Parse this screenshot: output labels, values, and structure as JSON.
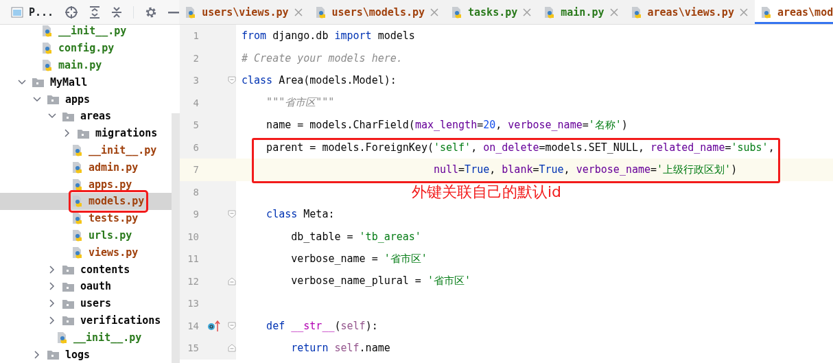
{
  "project_panel": {
    "title": "P..."
  },
  "tabs": [
    {
      "label": "users\\views.py",
      "color": "#a0410d",
      "selected": false,
      "closable": true
    },
    {
      "label": "users\\models.py",
      "color": "#a0410d",
      "selected": false,
      "closable": true
    },
    {
      "label": "tasks.py",
      "color": "#2a7a1c",
      "selected": false,
      "closable": true
    },
    {
      "label": "main.py",
      "color": "#2a7a1c",
      "selected": false,
      "closable": true
    },
    {
      "label": "areas\\views.py",
      "color": "#a0410d",
      "selected": false,
      "closable": true
    },
    {
      "label": "areas\\mod",
      "color": "#a0410d",
      "selected": true
    }
  ],
  "tree": [
    {
      "kind": "continued",
      "children": [
        {
          "kind": "file",
          "label": "__init__.py",
          "color": "#2a7a1c",
          "selected": false
        },
        {
          "kind": "file",
          "label": "config.py",
          "color": "#2a7a1c",
          "selected": false
        },
        {
          "kind": "file",
          "label": "main.py",
          "color": "#2a7a1c",
          "selected": false
        }
      ]
    },
    {
      "kind": "folder",
      "label": "MyMall",
      "expanded": true,
      "selected": false,
      "children": [
        {
          "kind": "folder",
          "label": "apps",
          "expanded": true,
          "selected": false,
          "children": [
            {
              "kind": "folder",
              "label": "areas",
              "expanded": true,
              "selected": false,
              "children": [
                {
                  "kind": "folder",
                  "label": "migrations",
                  "expanded": false,
                  "selected": false
                },
                {
                  "kind": "file",
                  "label": "__init__.py",
                  "color": "#a0410d",
                  "selected": false
                },
                {
                  "kind": "file",
                  "label": "admin.py",
                  "color": "#a0410d",
                  "selected": false
                },
                {
                  "kind": "file",
                  "label": "apps.py",
                  "color": "#a0410d",
                  "selected": false
                },
                {
                  "kind": "file",
                  "label": "models.py",
                  "color": "#a0410d",
                  "selected": true,
                  "boxed": true
                },
                {
                  "kind": "file",
                  "label": "tests.py",
                  "color": "#a0410d",
                  "selected": false
                },
                {
                  "kind": "file",
                  "label": "urls.py",
                  "color": "#2a7a1c",
                  "selected": false
                },
                {
                  "kind": "file",
                  "label": "views.py",
                  "color": "#a0410d",
                  "selected": false
                }
              ]
            },
            {
              "kind": "folder",
              "label": "contents",
              "expanded": false,
              "selected": false
            },
            {
              "kind": "folder",
              "label": "oauth",
              "expanded": false,
              "selected": false
            },
            {
              "kind": "folder",
              "label": "users",
              "expanded": false,
              "selected": false
            },
            {
              "kind": "folder",
              "label": "verifications",
              "expanded": false,
              "selected": false
            },
            {
              "kind": "file",
              "label": "__init__.py",
              "color": "#2a7a1c",
              "selected": false
            }
          ]
        },
        {
          "kind": "folder",
          "label": "logs",
          "expanded": false,
          "selected": false
        }
      ]
    }
  ],
  "code_lines": [
    {
      "number": "1",
      "current": false,
      "tokens": [
        {
          "text": "from",
          "kind": "kw"
        },
        {
          "text": " django.db ",
          "kind": "plain"
        },
        {
          "text": "import",
          "kind": "kw"
        },
        {
          "text": " models",
          "kind": "plain"
        }
      ]
    },
    {
      "number": "2",
      "current": false,
      "tokens": [
        {
          "text": "# Create your models here.",
          "kind": "cmt"
        }
      ]
    },
    {
      "number": "3",
      "current": false,
      "fold_start": true,
      "tokens": [
        {
          "text": "class",
          "kind": "kw"
        },
        {
          "text": " Area(models.Model):",
          "kind": "plain"
        }
      ]
    },
    {
      "number": "4",
      "current": false,
      "tokens": [
        {
          "text": "    \"\"\"省市区\"\"\"",
          "kind": "doc"
        }
      ]
    },
    {
      "number": "5",
      "current": false,
      "tokens": [
        {
          "text": "    name = models.CharField(",
          "kind": "plain"
        },
        {
          "text": "max_length",
          "kind": "param"
        },
        {
          "text": "=",
          "kind": "plain"
        },
        {
          "text": "20",
          "kind": "num"
        },
        {
          "text": ", ",
          "kind": "plain"
        },
        {
          "text": "verbose_name",
          "kind": "param"
        },
        {
          "text": "=",
          "kind": "plain"
        },
        {
          "text": "'名称'",
          "kind": "str"
        },
        {
          "text": ")",
          "kind": "plain"
        }
      ]
    },
    {
      "number": "6",
      "current": false,
      "boxed": true,
      "tokens": [
        {
          "text": "    parent = models.ForeignKey(",
          "kind": "plain"
        },
        {
          "text": "'self'",
          "kind": "str"
        },
        {
          "text": ", ",
          "kind": "plain"
        },
        {
          "text": "on_delete",
          "kind": "param"
        },
        {
          "text": "=models.SET_NULL, ",
          "kind": "plain"
        },
        {
          "text": "related_name",
          "kind": "param"
        },
        {
          "text": "=",
          "kind": "plain"
        },
        {
          "text": "'subs'",
          "kind": "str"
        },
        {
          "text": ",",
          "kind": "plain"
        }
      ]
    },
    {
      "number": "7",
      "current": true,
      "boxed": true,
      "tokens": [
        {
          "text": "                               null",
          "kind": "param"
        },
        {
          "text": "=",
          "kind": "plain"
        },
        {
          "text": "True",
          "kind": "kw"
        },
        {
          "text": ", ",
          "kind": "plain"
        },
        {
          "text": "blank",
          "kind": "param"
        },
        {
          "text": "=",
          "kind": "plain"
        },
        {
          "text": "True",
          "kind": "kw"
        },
        {
          "text": ", ",
          "kind": "plain"
        },
        {
          "text": "verbose_name",
          "kind": "param"
        },
        {
          "text": "=",
          "kind": "plain"
        },
        {
          "text": "'上级行政区划'",
          "kind": "str"
        },
        {
          "text": ")",
          "kind": "plain"
        }
      ]
    },
    {
      "number": "8",
      "current": false,
      "note": "外键关联自己的默认id"
    },
    {
      "number": "9",
      "current": false,
      "fold_start": true,
      "tokens": [
        {
          "text": "    class",
          "kind": "kw"
        },
        {
          "text": " Meta:",
          "kind": "plain"
        }
      ]
    },
    {
      "number": "10",
      "current": false,
      "tokens": [
        {
          "text": "        db_table = ",
          "kind": "plain"
        },
        {
          "text": "'tb_areas'",
          "kind": "str"
        }
      ]
    },
    {
      "number": "11",
      "current": false,
      "tokens": [
        {
          "text": "        verbose_name = ",
          "kind": "plain"
        },
        {
          "text": "'省市区'",
          "kind": "str"
        }
      ]
    },
    {
      "number": "12",
      "current": false,
      "fold_end": true,
      "tokens": [
        {
          "text": "        verbose_name_plural = ",
          "kind": "plain"
        },
        {
          "text": "'省市区'",
          "kind": "str"
        }
      ]
    },
    {
      "number": "13",
      "current": false
    },
    {
      "number": "14",
      "current": false,
      "fold_start": true,
      "override": true,
      "tokens": [
        {
          "text": "    def",
          "kind": "kw"
        },
        {
          "text": " __str__",
          "kind": "magic"
        },
        {
          "text": "(",
          "kind": "plain"
        },
        {
          "text": "self",
          "kind": "self"
        },
        {
          "text": "):",
          "kind": "plain"
        }
      ]
    },
    {
      "number": "15",
      "current": false,
      "fold_end": true,
      "tokens": [
        {
          "text": "        return",
          "kind": "kw"
        },
        {
          "text": " self",
          "kind": "self"
        },
        {
          "text": ".name",
          "kind": "plain"
        }
      ]
    }
  ]
}
